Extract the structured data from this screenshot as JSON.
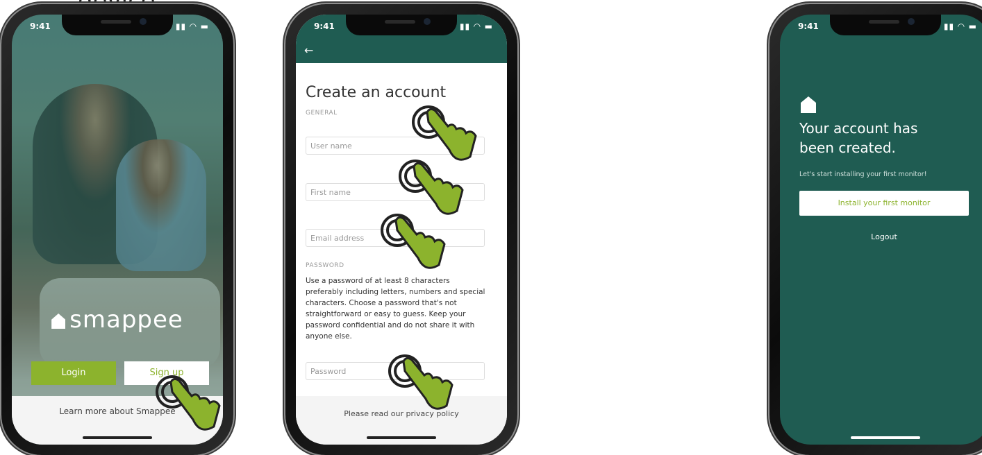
{
  "caption": "device",
  "status_time": "9:41",
  "phone1": {
    "logo": "smappee",
    "login": "Login",
    "signup": "Sign up",
    "learn_more": "Learn more about Smappee"
  },
  "phone2": {
    "title": "Create an account",
    "general": "GENERAL",
    "username": "User name",
    "firstname": "First name",
    "email": "Email address",
    "password_section": "PASSWORD",
    "password_help": "Use a password of at least 8 characters preferably including letters, numbers and special characters. Choose a password that's not straightforward or easy to guess. Keep your password confidential and do not share it with anyone else.",
    "password": "Password",
    "privacy": "Please read our privacy policy"
  },
  "phone3": {
    "title_line1": "Your account has",
    "title_line2": "been created.",
    "subtitle": "Let's start installing your first monitor!",
    "install": "Install your first monitor",
    "logout": "Logout"
  },
  "colors": {
    "brand_green": "#1f5c52",
    "accent_lime": "#8cb32d"
  }
}
